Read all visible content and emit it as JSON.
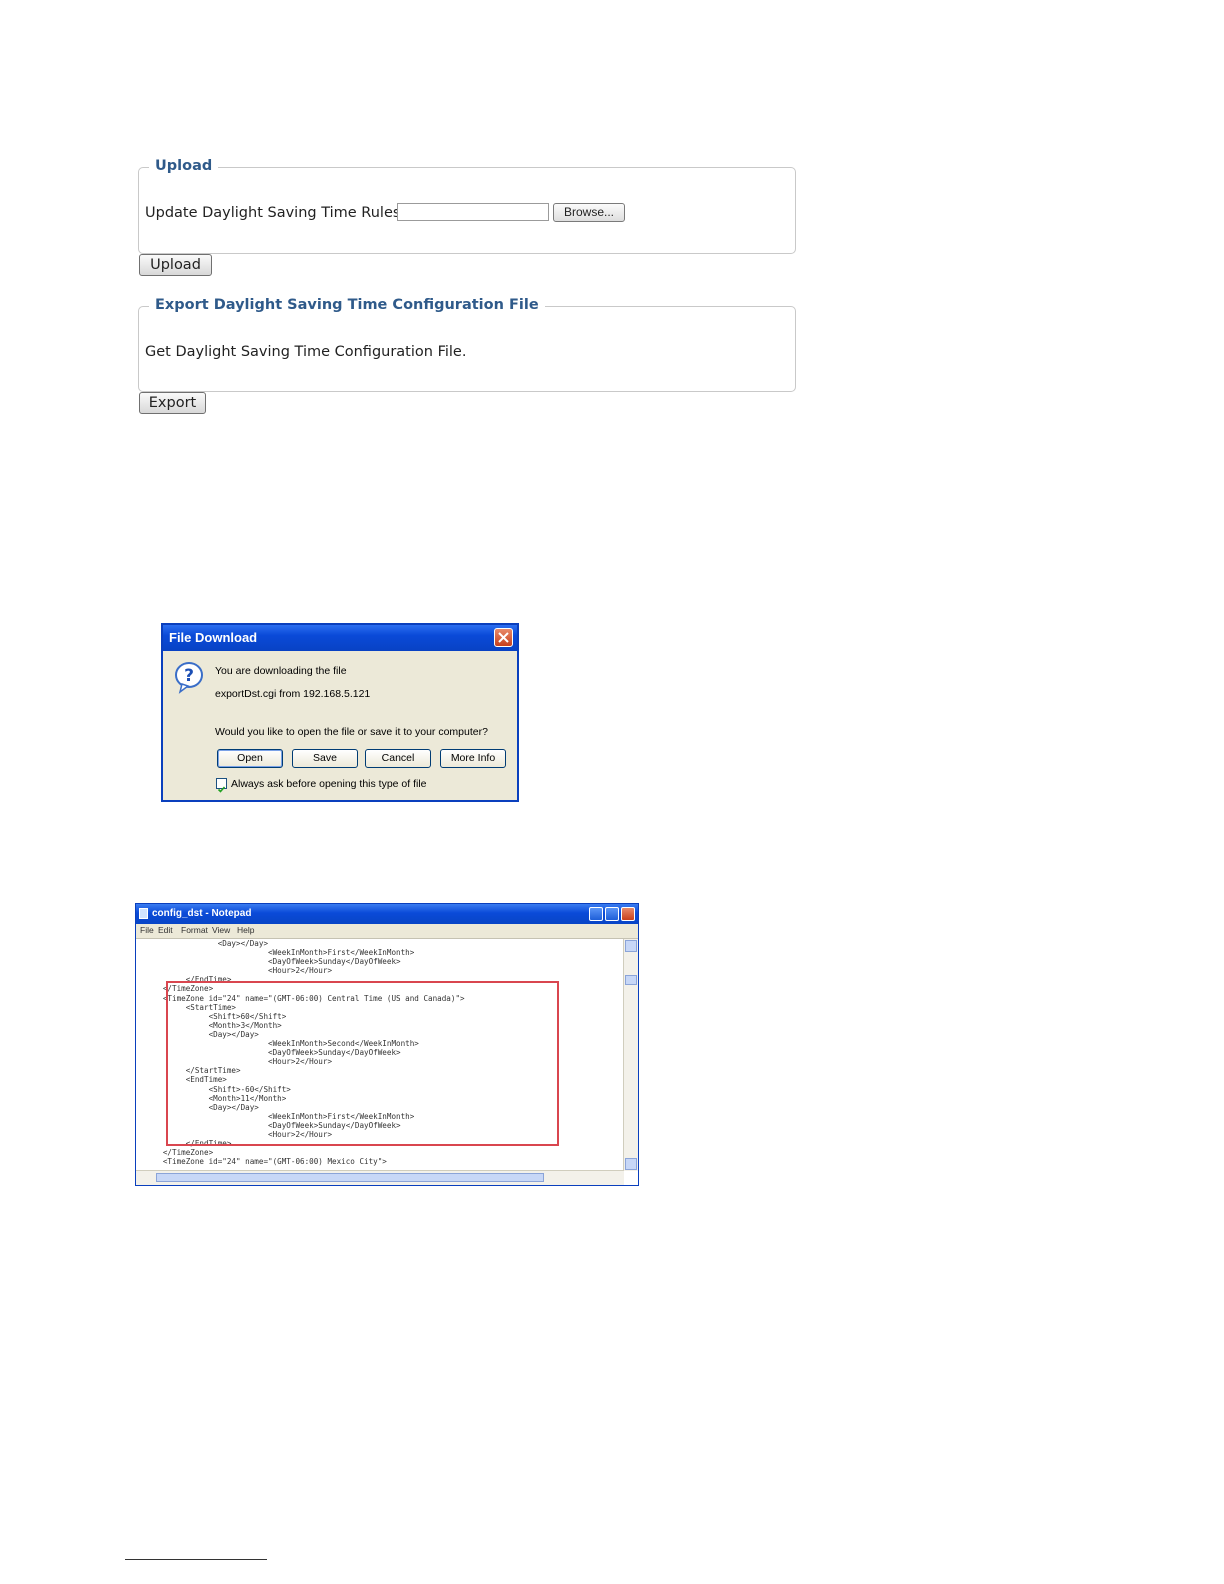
{
  "upload_panel": {
    "legend": "Upload",
    "label": "Update Daylight Saving Time Rules",
    "file_value": "",
    "browse_label": "Browse...",
    "submit_label": "Upload"
  },
  "export_panel": {
    "legend": "Export Daylight Saving Time Configuration File",
    "description": "Get Daylight Saving Time Configuration File.",
    "submit_label": "Export"
  },
  "file_download_dialog": {
    "title": "File Download",
    "line1": "You are downloading the file",
    "line2": "exportDst.cgi from 192.168.5.121",
    "question": "Would you like to open the file or save it to your computer?",
    "buttons": {
      "open": "Open",
      "save": "Save",
      "cancel": "Cancel",
      "more_info": "More Info"
    },
    "checkbox_label": "Always ask before opening this type of file",
    "checkbox_checked": true,
    "icon": "question-icon"
  },
  "notepad": {
    "title": "config_dst - Notepad",
    "menu": [
      "File",
      "Edit",
      "Format",
      "View",
      "Help"
    ],
    "content": "                 <Day></Day>\n                            <WeekInMonth>First</WeekInMonth>\n                            <DayOfWeek>Sunday</DayOfWeek>\n                            <Hour>2</Hour>\n          </EndTime>\n     </TimeZone>\n     <TimeZone id=\"24\" name=\"(GMT-06:00) Central Time (US and Canada)\">\n          <StartTime>\n               <Shift>60</Shift>\n               <Month>3</Month>\n               <Day></Day>\n                            <WeekInMonth>Second</WeekInMonth>\n                            <DayOfWeek>Sunday</DayOfWeek>\n                            <Hour>2</Hour>\n          </StartTime>\n          <EndTime>\n               <Shift>-60</Shift>\n               <Month>11</Month>\n               <Day></Day>\n                            <WeekInMonth>First</WeekInMonth>\n                            <DayOfWeek>Sunday</DayOfWeek>\n                            <Hour>2</Hour>\n          </EndTime>\n     </TimeZone>\n     <TimeZone id=\"24\" name=\"(GMT-06:00) Mexico City\">"
  }
}
